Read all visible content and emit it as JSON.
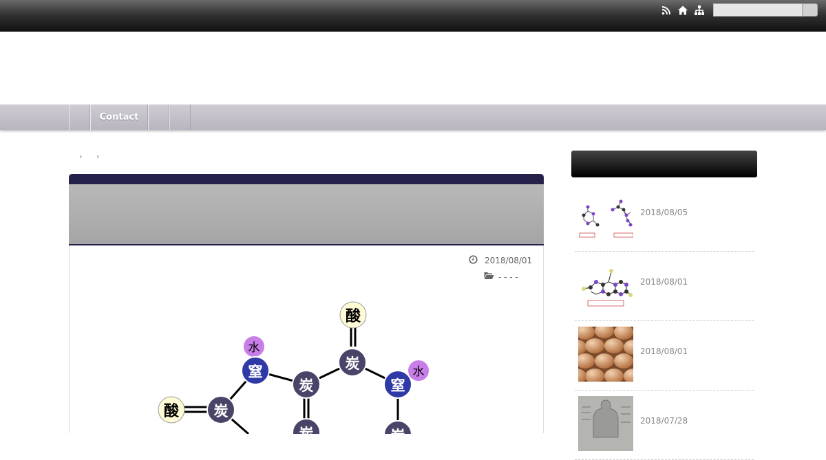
{
  "topbar": {
    "icons": [
      "rss-icon",
      "home-icon",
      "sitemap-icon"
    ],
    "search": {
      "placeholder": "",
      "value": ""
    }
  },
  "nav": {
    "items": [
      {
        "label": ""
      },
      {
        "label": "Contact"
      },
      {
        "label": ""
      },
      {
        "label": ""
      }
    ]
  },
  "breadcrumb": {
    "separators": [
      "›",
      "›"
    ]
  },
  "article": {
    "date": "2018/08/01",
    "category": "-  -  -    -",
    "molecule_atoms": {
      "oxygen": "酸",
      "carbon": "炭",
      "nitrogen": "窒",
      "hydrogen": "水"
    }
  },
  "sidebar": {
    "posts": [
      {
        "date": "2018/08/05"
      },
      {
        "date": "2018/08/01"
      },
      {
        "date": "2018/08/01"
      },
      {
        "date": "2018/07/28"
      }
    ]
  },
  "colors": {
    "header_accent": "#24214a",
    "carbon": "#4a4568",
    "nitrogen": "#2f3aa6",
    "hydrogen": "#c77ee8",
    "oxygen": "#fffbd6"
  }
}
